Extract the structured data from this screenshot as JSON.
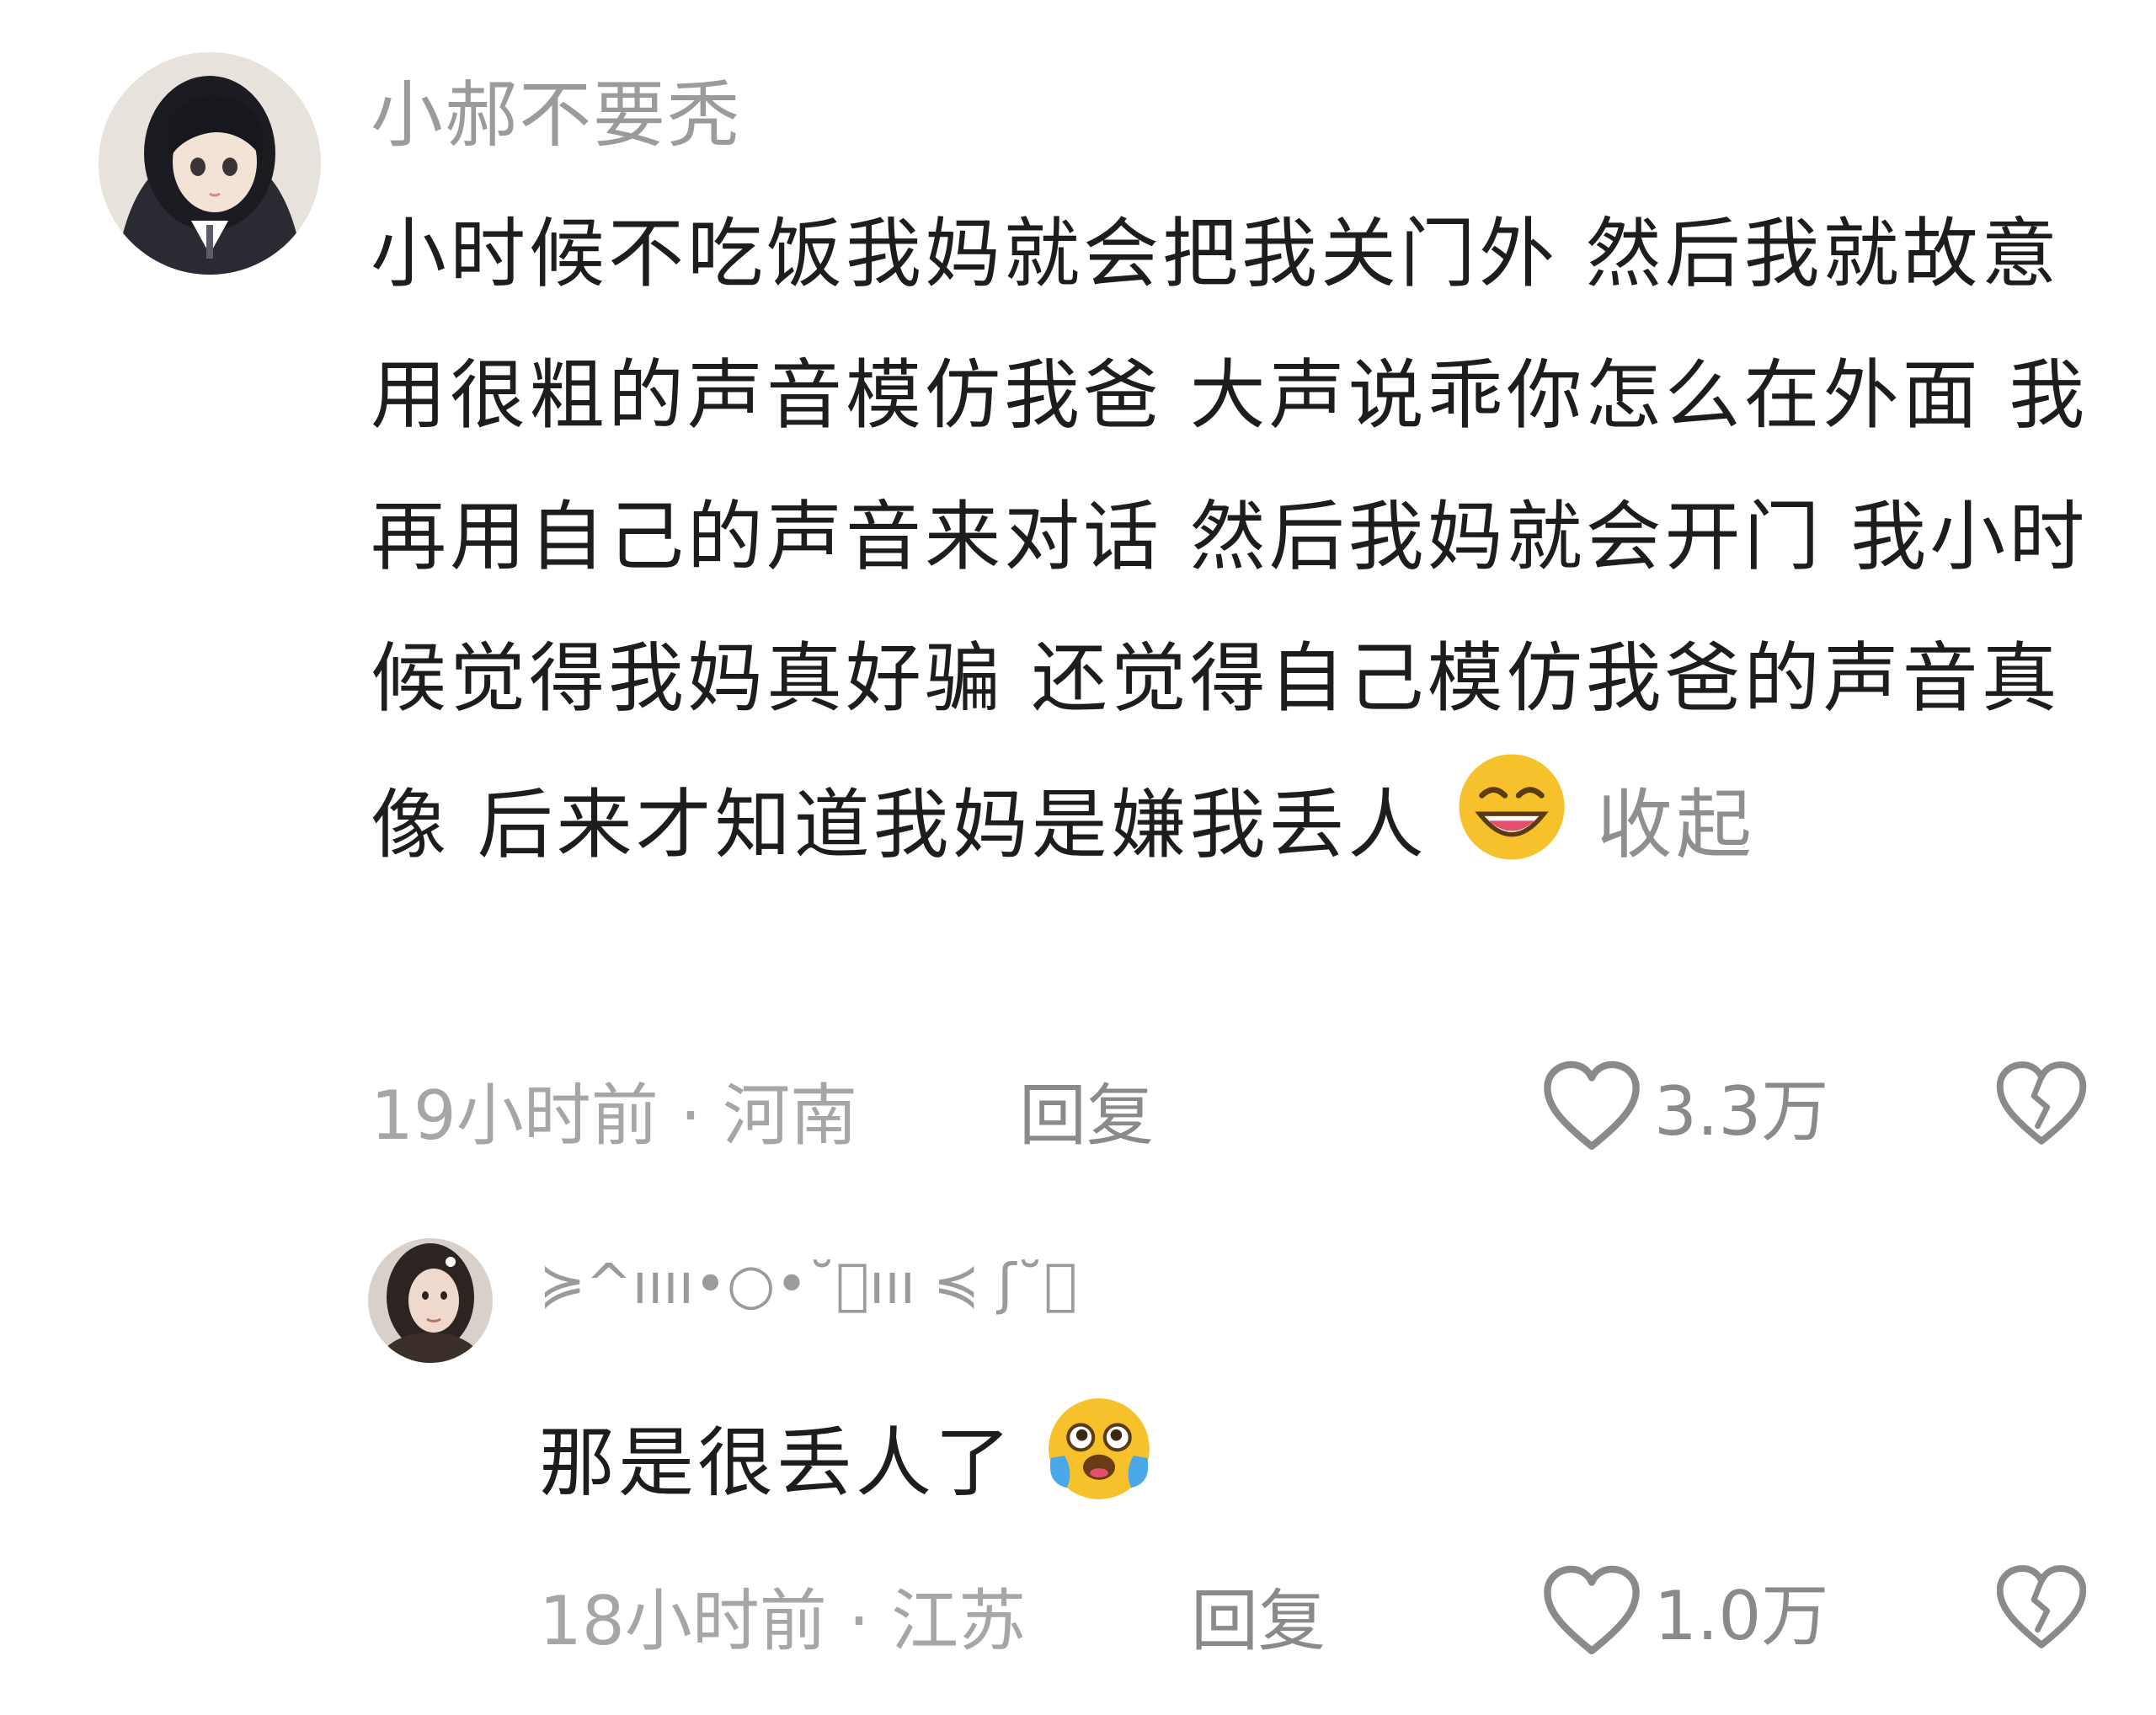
{
  "comments": [
    {
      "username": "小郝不要秃",
      "text": "小时候不吃饭我妈就会把我关门外 然后我就故意用很粗的声音模仿我爸 大声说乖你怎么在外面 我再用自己的声音来对话 然后我妈就会开门 我小时候觉得我妈真好骗 还觉得自己模仿我爸的声音真像 后来才知道我妈是嫌我丢人",
      "emoji": "grinning-sweat-emoji",
      "collapse_label": "收起",
      "time": "19小时前",
      "separator": "·",
      "location": "河南",
      "reply_label": "回复",
      "like_count": "3.3万"
    },
    {
      "username": "≽^ıııı•○•˘⃝ııı ≼ ʃ˘⃝",
      "text": "那是很丢人了",
      "emoji": "crying-laughing-emoji",
      "time": "18小时前",
      "separator": "·",
      "location": "江苏",
      "reply_label": "回复",
      "like_count": "1.0万"
    }
  ],
  "colors": {
    "username": "#9b9b9b",
    "content": "#1d1d1d",
    "meta": "#a6a6a6",
    "action": "#8a8a8a",
    "emoji_face": "#f7c12b"
  },
  "icons": {
    "like": "heart-outline-icon",
    "dislike": "broken-heart-icon"
  }
}
